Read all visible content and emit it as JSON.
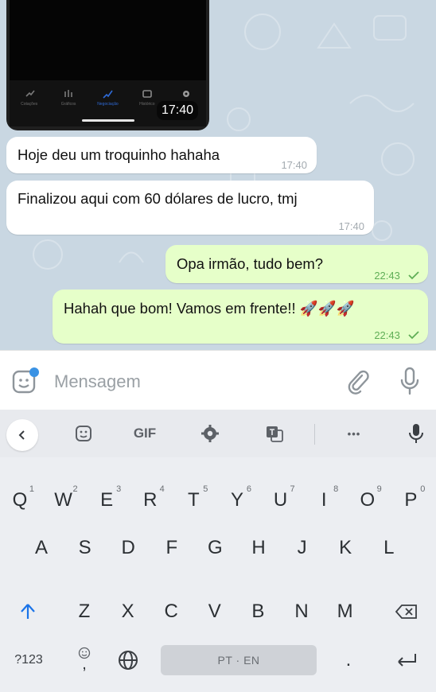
{
  "colors": {
    "chat_bg": "#c9d7e2",
    "incoming": "#ffffff",
    "outgoing": "#e6ffc9",
    "tick": "#5fae56",
    "keyboard_bg": "#eceef2",
    "shift_blue": "#1a73e8"
  },
  "media_message": {
    "nav_items": [
      {
        "label": "Cotações",
        "icon": "candlestick-icon"
      },
      {
        "label": "Gráficos",
        "icon": "chart-bars-icon"
      },
      {
        "label": "Negociação",
        "icon": "trade-icon",
        "active": true
      },
      {
        "label": "Histórico",
        "icon": "history-icon"
      },
      {
        "label": "",
        "icon": "gear-icon"
      }
    ],
    "time": "17:40"
  },
  "messages": [
    {
      "direction": "in",
      "text": "Hoje deu um troquinho hahaha",
      "time": "17:40"
    },
    {
      "direction": "in",
      "text": "Finalizou aqui com 60 dólares de lucro, tmj",
      "time": "17:40"
    },
    {
      "direction": "out",
      "text": "Opa irmão, tudo bem?",
      "time": "22:43",
      "read": true
    },
    {
      "direction": "out",
      "text": "Hahah que bom! Vamos em frente!! 🚀🚀🚀",
      "time": "22:43",
      "read": true
    }
  ],
  "input": {
    "placeholder": "Mensagem"
  },
  "keyboard": {
    "toolbar": {
      "gif_label": "GIF",
      "more_label": "•••"
    },
    "row1": [
      "Q",
      "W",
      "E",
      "R",
      "T",
      "Y",
      "U",
      "I",
      "O",
      "P"
    ],
    "row1_hints": [
      "1",
      "2",
      "3",
      "4",
      "5",
      "6",
      "7",
      "8",
      "9",
      "0"
    ],
    "row2": [
      "A",
      "S",
      "D",
      "F",
      "G",
      "H",
      "J",
      "K",
      "L"
    ],
    "row3": [
      "Z",
      "X",
      "C",
      "V",
      "B",
      "N",
      "M"
    ],
    "symbols_label": "?123",
    "emoji_comma_label": ",",
    "space_label": "PT · EN",
    "period_label": "."
  }
}
